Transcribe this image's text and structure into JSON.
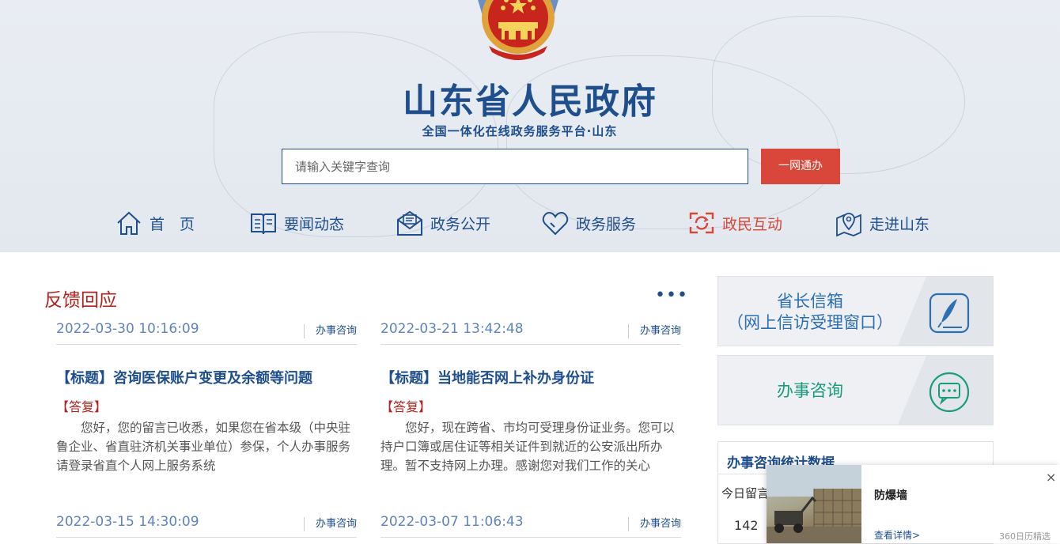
{
  "header": {
    "title": "山东省人民政府",
    "subtitle": "全国一体化在线政务服务平台·山东"
  },
  "search": {
    "placeholder": "请输入关键字查询",
    "button_label": "一网通办"
  },
  "nav": {
    "items": [
      {
        "label": "首　页",
        "icon": "home-icon"
      },
      {
        "label": "要闻动态",
        "icon": "book-icon"
      },
      {
        "label": "政务公开",
        "icon": "envelope-icon"
      },
      {
        "label": "政务服务",
        "icon": "heart-icon"
      },
      {
        "label": "政民互动",
        "icon": "interaction-icon",
        "active": true
      },
      {
        "label": "走进山东",
        "icon": "map-pin-icon"
      }
    ]
  },
  "feedback": {
    "section_title": "反馈回应",
    "more": "•••",
    "cards": [
      {
        "date": "2022-03-30 10:16:09",
        "category": "办事咨询",
        "title": "【标题】咨询医保账户变更及余额等问题",
        "answer_label": "【答复】",
        "answer": "您好，您的留言已收悉，如果您在省本级（中央驻鲁企业、省直驻济机关事业单位）参保，个人办事服务请登录省直个人网上服务系统"
      },
      {
        "date": "2022-03-21 13:42:48",
        "category": "办事咨询",
        "title": "【标题】当地能否网上补办身份证",
        "answer_label": "【答复】",
        "answer": "您好，现在跨省、市均可受理身份证业务。您可以持户口簿或居住证等相关证件到就近的公安派出所办理。暂不支持网上办理。感谢您对我们工作的关心"
      },
      {
        "date": "2022-03-15 14:30:09",
        "category": "办事咨询"
      },
      {
        "date": "2022-03-07 11:06:43",
        "category": "办事咨询"
      }
    ]
  },
  "sidebar": {
    "governor_mailbox": {
      "line1": "省长信箱",
      "line2": "（网上信访受理窗口）"
    },
    "consultation": {
      "label": "办事咨询"
    },
    "stats": {
      "title": "办事咨询统计数据",
      "col1_label": "今日留言",
      "col1_value": "142"
    }
  },
  "popup": {
    "title": "防爆墙",
    "link": "查看详情>",
    "brand": "360日历精选",
    "close": "×"
  },
  "colors": {
    "brand_blue": "#1f4e8c",
    "accent_red": "#d9473a",
    "title_red": "#b3211c"
  }
}
